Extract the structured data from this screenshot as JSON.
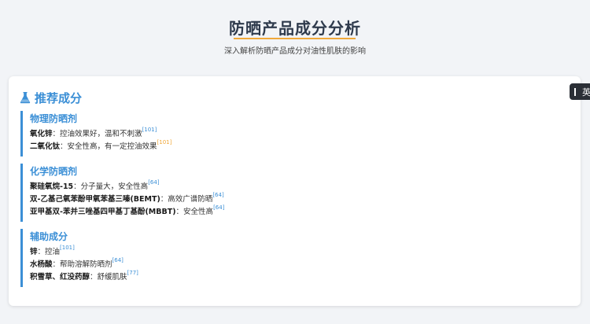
{
  "header": {
    "title": "防晒产品成分分析",
    "subtitle": "深入解析防晒产品成分对油性肌肤的影响"
  },
  "card": {
    "heading": "推荐成分",
    "groups": [
      {
        "title": "物理防晒剂",
        "items": [
          {
            "name": "氧化锌",
            "desc": "：控油效果好，温和不刺激",
            "ref": "[101]"
          },
          {
            "name": "二氧化钛",
            "desc": "：安全性高，有一定控油效果",
            "ref": "[101]"
          }
        ]
      },
      {
        "title": "化学防晒剂",
        "items": [
          {
            "name": "聚硅氧烷-15",
            "desc": "：分子量大，安全性高",
            "ref": "[64]"
          },
          {
            "name": "双-乙基己氧苯酚甲氧苯基三嗪(BEMT)",
            "desc": "：高效广谱防晒",
            "ref": "[64]"
          },
          {
            "name": "亚甲基双-苯并三唑基四甲基丁基酚(MBBT)",
            "desc": "：安全性高",
            "ref": "[64]"
          }
        ]
      },
      {
        "title": "辅助成分",
        "items": [
          {
            "name": "锌",
            "desc": "：控油",
            "ref": "[101]"
          },
          {
            "name": "水杨酸",
            "desc": "：帮助溶解防晒剂",
            "ref": "[64]"
          },
          {
            "name": "积雪草、红没药醇",
            "desc": "：舒缓肌肤",
            "ref": "[77]"
          }
        ]
      }
    ]
  },
  "lang_toggle": {
    "label": "英"
  },
  "colors": {
    "accent": "#3b8fd6",
    "underline": "#f0a83a",
    "title": "#2e3a4c"
  },
  "icons": {
    "heading_icon": "flask-icon"
  }
}
